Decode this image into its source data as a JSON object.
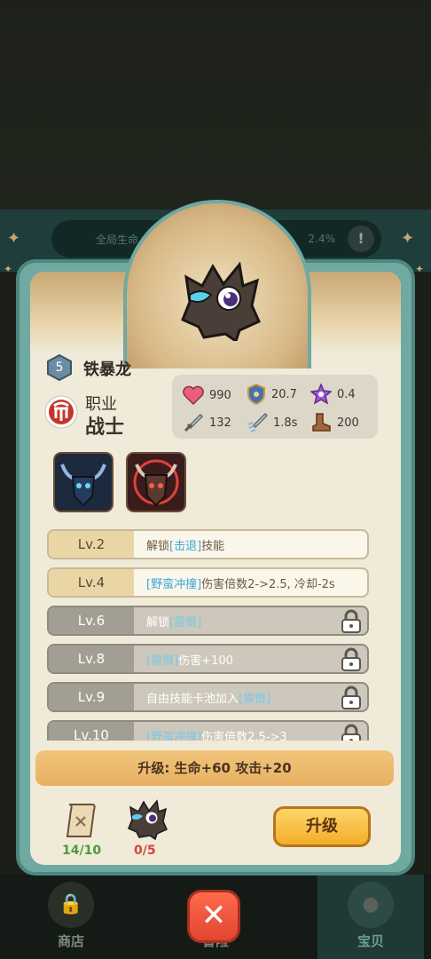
{
  "background": {
    "global_label": "全局生命",
    "global_value": "2.4%",
    "warn_symbol": "!"
  },
  "pet": {
    "level": "5",
    "name": "铁暴龙",
    "class_label": "职业",
    "class_value": "战士"
  },
  "stats": [
    {
      "icon": "heart-icon",
      "value": "990"
    },
    {
      "icon": "shield-icon",
      "value": "20.7"
    },
    {
      "icon": "crit-star-icon",
      "value": "0.4"
    },
    {
      "icon": "sword-icon",
      "value": "132"
    },
    {
      "icon": "attack-speed-icon",
      "value": "1.8s"
    },
    {
      "icon": "boot-icon",
      "value": "200"
    }
  ],
  "skills": [
    {
      "icon": "dark-bull-skill-icon"
    },
    {
      "icon": "red-bull-skill-icon"
    }
  ],
  "level_rows": [
    {
      "lv": "Lv.2",
      "pre": "解锁",
      "kw": "[击退]",
      "post": "技能",
      "locked": false
    },
    {
      "lv": "Lv.4",
      "pre": "",
      "kw": "[野蛮冲撞]",
      "post": "伤害倍数2->2.5, 冷却-2s",
      "locked": false
    },
    {
      "lv": "Lv.6",
      "pre": "解锁",
      "kw": "[震慑]",
      "post": "",
      "locked": true
    },
    {
      "lv": "Lv.8",
      "pre": "",
      "kw": "[震慑]",
      "post": "伤害+100",
      "locked": true
    },
    {
      "lv": "Lv.9",
      "pre": "自由技能卡池加入",
      "kw": "[震慑]",
      "post": "",
      "locked": true
    },
    {
      "lv": "Lv.10",
      "pre": "",
      "kw": "[野蛮冲撞]",
      "post": "伤害倍数2.5->3",
      "locked": true
    }
  ],
  "upgrade_info": "升级: 生命+60 攻击+20",
  "resources": {
    "scroll": "14/10",
    "scroll_color": "#4f9a3a",
    "pet_shard": "0/5",
    "pet_shard_color": "#d0453a"
  },
  "upgrade_button": "升级",
  "close_symbol": "✕",
  "nav": {
    "shop": "商店",
    "adventure": "冒险",
    "pets": "宝贝"
  },
  "colors": {
    "accent_teal": "#6fa9a2",
    "panel": "#f0ead8",
    "keyword_blue": "#3ea7d6"
  }
}
